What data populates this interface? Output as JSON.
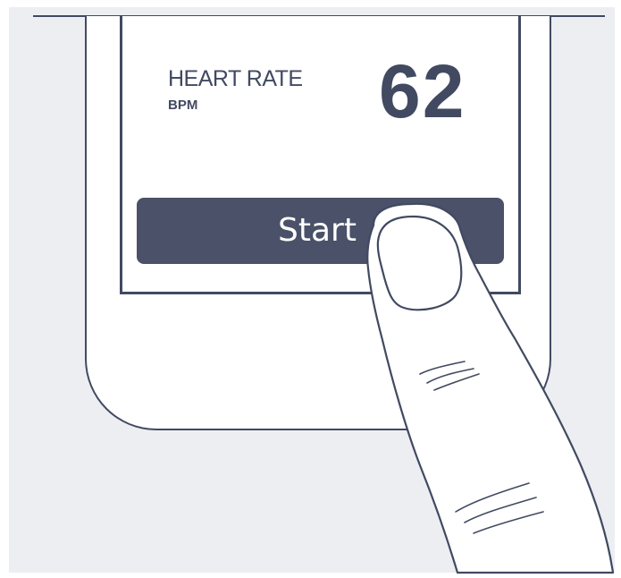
{
  "metric": {
    "label": "HEART RATE",
    "unit": "BPM",
    "value": "62"
  },
  "actions": {
    "start_label": "Start"
  },
  "colors": {
    "background": "#eceef2",
    "ink": "#414a61",
    "button": "#4a5168",
    "screen": "#ffffff"
  },
  "icons": {
    "finger": "finger-tap-icon"
  }
}
